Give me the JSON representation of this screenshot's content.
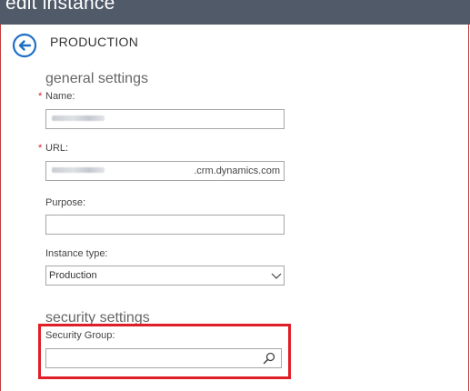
{
  "header": {
    "title": "edit instance"
  },
  "instance": {
    "name": "PRODUCTION"
  },
  "general": {
    "title": "general settings",
    "name_label": "Name:",
    "url_label": "URL:",
    "url_suffix": ".crm.dynamics.com",
    "purpose_label": "Purpose:",
    "purpose_value": "",
    "type_label": "Instance type:",
    "type_value": "Production",
    "required_marker": "*"
  },
  "security": {
    "title": "security settings",
    "group_label": "Security Group:",
    "group_value": ""
  },
  "colors": {
    "header_bg": "#505a68",
    "accent_blue": "#1f6fc5",
    "highlight_red": "#e01e26"
  },
  "icons": {
    "back": "back-arrow-circle-icon",
    "search": "search-icon",
    "dropdown": "chevron-down-icon"
  }
}
